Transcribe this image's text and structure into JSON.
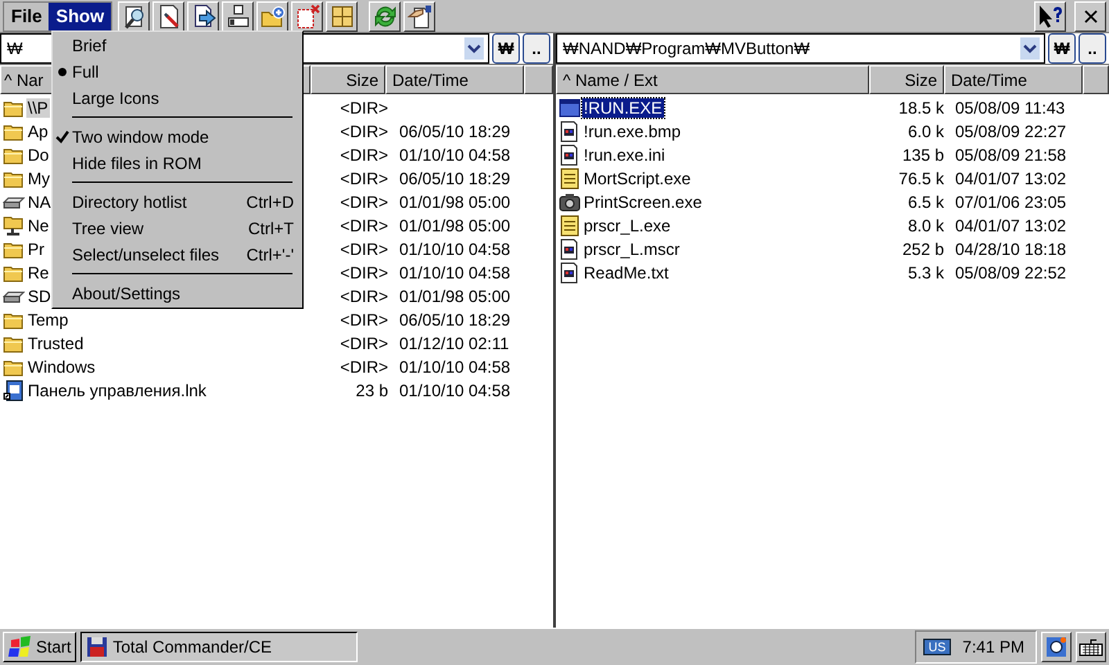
{
  "menu_bar": [
    {
      "label": "File",
      "selected": false
    },
    {
      "label": "Show",
      "selected": true
    }
  ],
  "show_menu": [
    {
      "kind": "radio",
      "label": "Brief",
      "checked": false
    },
    {
      "kind": "radio",
      "label": "Full",
      "checked": true
    },
    {
      "kind": "radio",
      "label": "Large Icons",
      "checked": false
    },
    {
      "kind": "separator"
    },
    {
      "kind": "check",
      "label": "Two window mode",
      "checked": true
    },
    {
      "kind": "check",
      "label": "Hide files in ROM",
      "checked": false
    },
    {
      "kind": "separator"
    },
    {
      "kind": "plain",
      "label": "Directory hotlist",
      "shortcut": "Ctrl+D"
    },
    {
      "kind": "plain",
      "label": "Tree view",
      "shortcut": "Ctrl+T"
    },
    {
      "kind": "plain",
      "label": "Select/unselect files",
      "shortcut": "Ctrl+'-'"
    },
    {
      "kind": "separator"
    },
    {
      "kind": "plain",
      "label": "About/Settings"
    }
  ],
  "panels": [
    {
      "active": false,
      "path": "₩",
      "root_button": "₩",
      "up_button": "..",
      "columns": [
        "^ Nar",
        "Size",
        "Date/Time"
      ],
      "rows": [
        {
          "kind": "folder",
          "name": "\\\\P",
          "size": "<DIR>",
          "selected": true
        },
        {
          "kind": "folder",
          "name": "Ap",
          "size": "<DIR>",
          "date": "06/05/10 18:29",
          "selected": false
        },
        {
          "kind": "folder",
          "name": "Do",
          "size": "<DIR>",
          "date": "01/10/10 04:58",
          "selected": false
        },
        {
          "kind": "folder",
          "name": "My",
          "size": "<DIR>",
          "date": "06/05/10 18:29",
          "selected": false
        },
        {
          "kind": "drive",
          "name": "NA",
          "size": "<DIR>",
          "date": "01/01/98 05:00",
          "selected": false
        },
        {
          "kind": "network",
          "name": "Ne",
          "size": "<DIR>",
          "date": "01/01/98 05:00",
          "selected": false
        },
        {
          "kind": "folder",
          "name": "Pr",
          "size": "<DIR>",
          "date": "01/10/10 04:58",
          "selected": false
        },
        {
          "kind": "folder",
          "name": "Re",
          "size": "<DIR>",
          "date": "01/10/10 04:58",
          "selected": false
        },
        {
          "kind": "drive",
          "name": "SD",
          "size": "<DIR>",
          "date": "01/01/98 05:00",
          "selected": false
        },
        {
          "kind": "folder",
          "name": "Temp",
          "size": "<DIR>",
          "date": "06/05/10 18:29",
          "selected": false
        },
        {
          "kind": "folder",
          "name": "Trusted",
          "size": "<DIR>",
          "date": "01/12/10 02:11",
          "selected": false
        },
        {
          "kind": "folder",
          "name": "Windows",
          "size": "<DIR>",
          "date": "01/10/10 04:58",
          "selected": false
        },
        {
          "kind": "shortcut",
          "name": "Панель управления.lnk",
          "size": "23 b",
          "date": "01/10/10 04:58",
          "selected": false
        }
      ]
    },
    {
      "active": true,
      "path": "₩NAND₩Program₩MVButton₩",
      "root_button": "₩",
      "up_button": "..",
      "columns": [
        "^ Name / Ext",
        "Size",
        "Date/Time"
      ],
      "rows": [
        {
          "kind": "exe",
          "name": "!RUN.EXE",
          "size": "18.5 k",
          "date": "05/08/09 11:43",
          "selected": true
        },
        {
          "kind": "file",
          "name": "!run.exe.bmp",
          "size": "6.0 k",
          "date": "05/08/09 22:27",
          "selected": false
        },
        {
          "kind": "file",
          "name": "!run.exe.ini",
          "size": "135 b",
          "date": "05/08/09 21:58",
          "selected": false
        },
        {
          "kind": "script",
          "name": "MortScript.exe",
          "size": "76.5 k",
          "date": "04/01/07 13:02",
          "selected": false
        },
        {
          "kind": "camera",
          "name": "PrintScreen.exe",
          "size": "6.5 k",
          "date": "07/01/06 23:05",
          "selected": false
        },
        {
          "kind": "script",
          "name": "prscr_L.exe",
          "size": "8.0 k",
          "date": "04/01/07 13:02",
          "selected": false
        },
        {
          "kind": "file",
          "name": "prscr_L.mscr",
          "size": "252 b",
          "date": "04/28/10 18:18",
          "selected": false
        },
        {
          "kind": "file",
          "name": "ReadMe.txt",
          "size": "5.3 k",
          "date": "05/08/09 22:52",
          "selected": false
        }
      ]
    }
  ],
  "taskbar": {
    "start": "Start",
    "task": "Total Commander/CE",
    "input_language": "US",
    "clock": "7:41 PM"
  }
}
